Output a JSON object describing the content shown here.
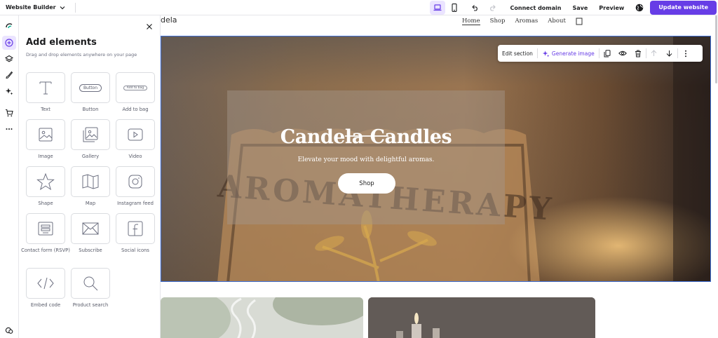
{
  "topbar": {
    "app_name": "Website Builder",
    "connect_domain": "Connect domain",
    "save": "Save",
    "preview": "Preview",
    "update": "Update website"
  },
  "panel": {
    "title": "Add elements",
    "subtitle": "Drag and drop elements anywhere on your page",
    "items": [
      {
        "label": "Text",
        "icon": "text-icon"
      },
      {
        "label": "Button",
        "icon": "button-icon",
        "preview": "Button"
      },
      {
        "label": "Add to bag",
        "icon": "add-to-bag-icon",
        "preview": "Add to bag"
      },
      {
        "label": "Image",
        "icon": "image-icon"
      },
      {
        "label": "Gallery",
        "icon": "gallery-icon"
      },
      {
        "label": "Video",
        "icon": "video-icon"
      },
      {
        "label": "Shape",
        "icon": "star-icon"
      },
      {
        "label": "Map",
        "icon": "map-icon"
      },
      {
        "label": "Instagram feed",
        "icon": "instagram-icon"
      },
      {
        "label": "Contact form (RSVP)",
        "icon": "contact-form-icon"
      },
      {
        "label": "Subscribe",
        "icon": "envelope-icon"
      },
      {
        "label": "Social icons",
        "icon": "facebook-icon"
      },
      {
        "label": "Embed code",
        "icon": "code-icon"
      },
      {
        "label": "Product search",
        "icon": "search-icon"
      }
    ]
  },
  "site": {
    "logo": "dela",
    "nav": [
      "Home",
      "Shop",
      "Aromas",
      "About"
    ],
    "hero_title": "Candela Candles",
    "hero_subtitle": "Elevate your mood with delightful aromas.",
    "hero_button": "Shop",
    "background_text": "AROMATHERAPY"
  },
  "section_toolbar": {
    "edit": "Edit section",
    "generate": "Generate image"
  },
  "colors": {
    "accent": "#673de6",
    "selection": "#3f6fd6"
  }
}
